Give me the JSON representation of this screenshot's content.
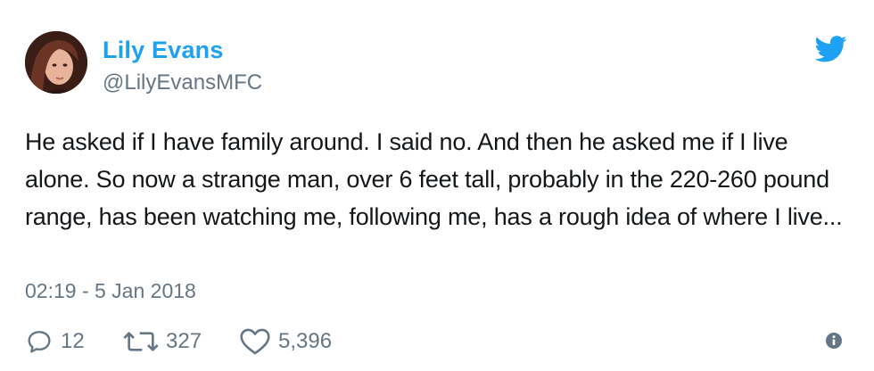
{
  "user": {
    "display_name": "Lily Evans",
    "handle": "@LilyEvansMFC",
    "avatar_icon": "profile-photo"
  },
  "tweet": {
    "text": "He asked if I have family around. I said no. And then he asked me if I live alone. So now a strange man, over 6 feet tall, probably in the 220-260 pound range, has been watching me, following me, has a rough idea of where I live...",
    "timestamp": "02:19 - 5 Jan 2018"
  },
  "actions": {
    "replies": "12",
    "retweets": "327",
    "likes": "5,396"
  },
  "icons": {
    "brand": "twitter-bird-icon",
    "reply": "reply-icon",
    "retweet": "retweet-icon",
    "like": "heart-icon",
    "info": "info-icon"
  },
  "colors": {
    "brand": "#1da1f2",
    "text": "#14171a",
    "muted": "#657786"
  }
}
